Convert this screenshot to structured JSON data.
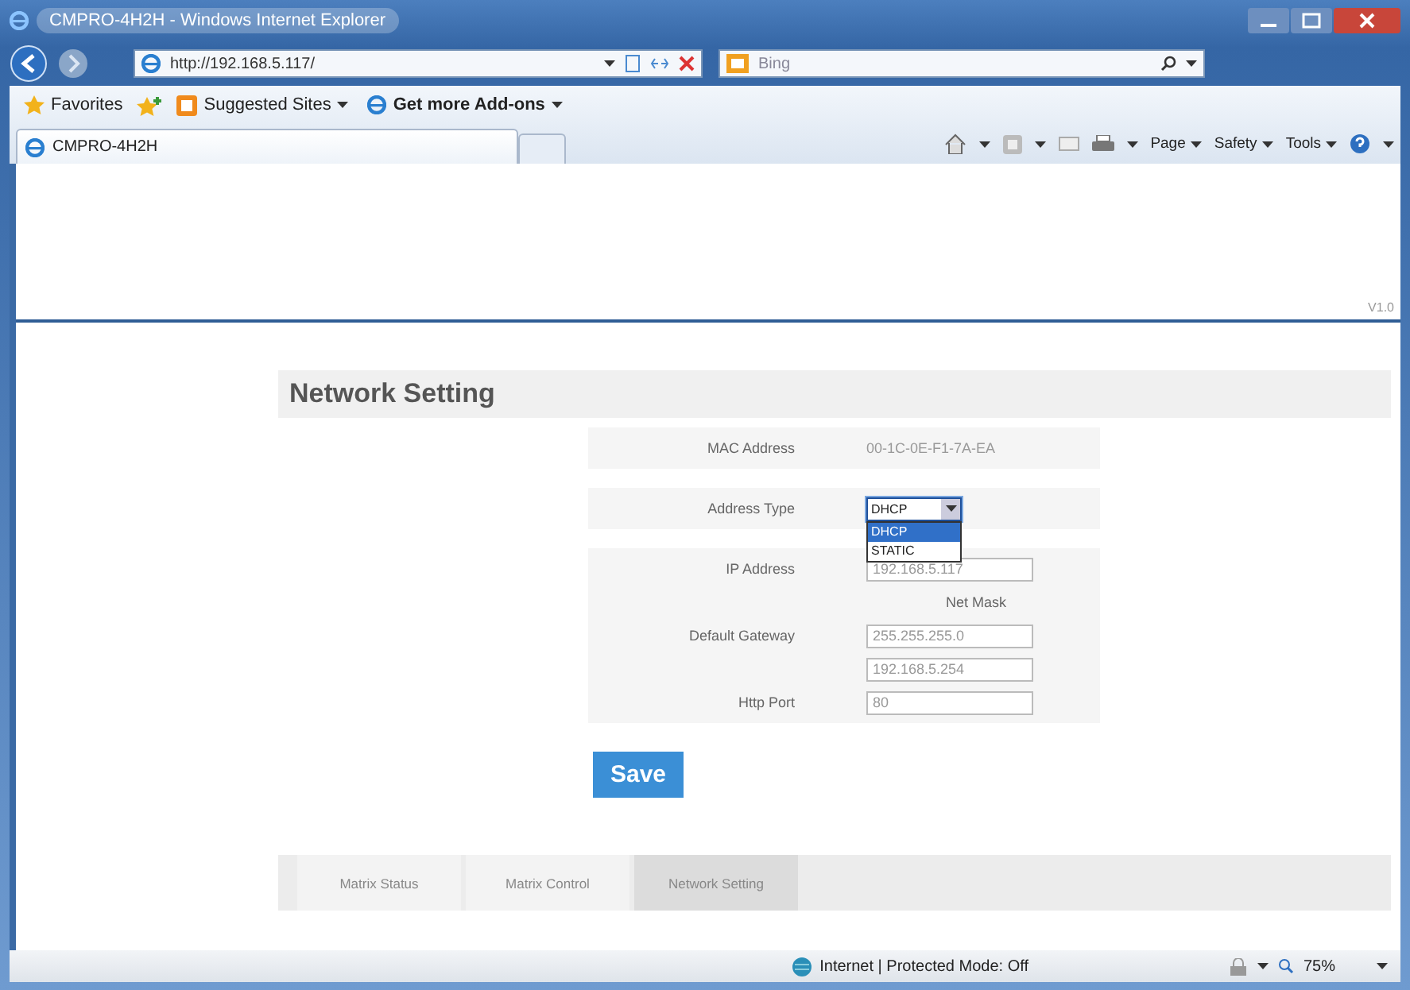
{
  "window": {
    "title": "CMPRO-4H2H - Windows Internet Explorer"
  },
  "address_bar": {
    "url": "http://192.168.5.117/"
  },
  "search": {
    "placeholder": "Bing"
  },
  "favorites_bar": {
    "items": [
      {
        "label": "Favorites",
        "kind": "favorites"
      },
      {
        "label": "Suggested Sites",
        "kind": "feed"
      },
      {
        "label": "Get more Add-ons",
        "kind": "addons"
      }
    ]
  },
  "tabs": [
    {
      "label": "CMPRO-4H2H",
      "selected": true
    }
  ],
  "command_bar": {
    "items": [
      "Page",
      "Safety",
      "Tools"
    ]
  },
  "page": {
    "version": "V1.0",
    "heading": "Network Setting",
    "form": {
      "groups": [
        {
          "rows": [
            {
              "kind": "text",
              "label": "MAC Address",
              "value": "00-1C-0E-F1-7A-EA"
            }
          ]
        },
        {
          "rows": [
            {
              "kind": "select",
              "label": "Address Type",
              "value": "DHCP",
              "expanded": true,
              "options": [
                {
                  "label": "DHCP",
                  "selected": true
                },
                {
                  "label": "STATIC",
                  "selected": false
                }
              ]
            }
          ]
        },
        {
          "rows": [
            {
              "kind": "input",
              "label": "IP Address",
              "value": "192.168.5.117"
            },
            {
              "kind": "caption",
              "value": "Net Mask"
            },
            {
              "kind": "input",
              "label": "Default Gateway",
              "value": "255.255.255.0"
            },
            {
              "kind": "input",
              "value": "192.168.5.254"
            },
            {
              "kind": "input",
              "label": "Http Port",
              "value": "80"
            }
          ]
        }
      ]
    },
    "save_button": "Save",
    "nav_tabs": [
      {
        "label": "Matrix Status",
        "selected": false
      },
      {
        "label": "Matrix Control",
        "selected": false
      },
      {
        "label": "Network Setting",
        "selected": true
      }
    ]
  },
  "status_bar": {
    "zone": "Internet | Protected Mode: Off",
    "zoom": "75%"
  }
}
